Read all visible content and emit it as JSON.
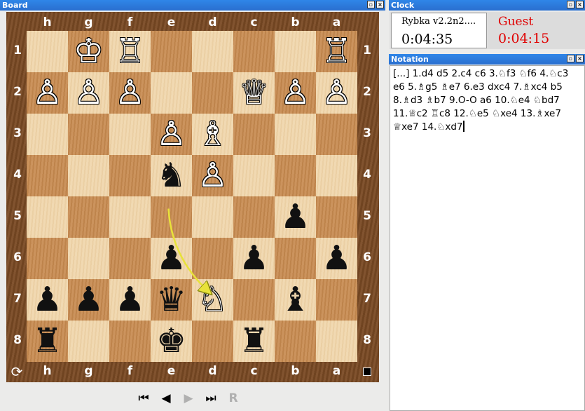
{
  "panels": {
    "board_title": "Board",
    "clock_title": "Clock",
    "notation_title": "Notation"
  },
  "board": {
    "files": [
      "h",
      "g",
      "f",
      "e",
      "d",
      "c",
      "b",
      "a"
    ],
    "ranks": [
      "1",
      "2",
      "3",
      "4",
      "5",
      "6",
      "7",
      "8"
    ],
    "pieces": [
      {
        "sq": "g1",
        "p": "♔",
        "c": "w",
        "name": "white-king"
      },
      {
        "sq": "f1",
        "p": "♖",
        "c": "w",
        "name": "white-rook"
      },
      {
        "sq": "a1",
        "p": "♖",
        "c": "w",
        "name": "white-rook"
      },
      {
        "sq": "h2",
        "p": "♙",
        "c": "w",
        "name": "white-pawn"
      },
      {
        "sq": "g2",
        "p": "♙",
        "c": "w",
        "name": "white-pawn"
      },
      {
        "sq": "f2",
        "p": "♙",
        "c": "w",
        "name": "white-pawn"
      },
      {
        "sq": "c2",
        "p": "♕",
        "c": "w",
        "name": "white-queen"
      },
      {
        "sq": "b2",
        "p": "♙",
        "c": "w",
        "name": "white-pawn"
      },
      {
        "sq": "a2",
        "p": "♙",
        "c": "w",
        "name": "white-pawn"
      },
      {
        "sq": "e3",
        "p": "♙",
        "c": "w",
        "name": "white-pawn"
      },
      {
        "sq": "d3",
        "p": "♗",
        "c": "w",
        "name": "white-bishop"
      },
      {
        "sq": "e4",
        "p": "♞",
        "c": "b",
        "name": "black-knight"
      },
      {
        "sq": "d4",
        "p": "♙",
        "c": "w",
        "name": "white-pawn"
      },
      {
        "sq": "b5",
        "p": "♟",
        "c": "b",
        "name": "black-pawn"
      },
      {
        "sq": "e6",
        "p": "♟",
        "c": "b",
        "name": "black-pawn"
      },
      {
        "sq": "c6",
        "p": "♟",
        "c": "b",
        "name": "black-pawn"
      },
      {
        "sq": "a6",
        "p": "♟",
        "c": "b",
        "name": "black-pawn"
      },
      {
        "sq": "h7",
        "p": "♟",
        "c": "b",
        "name": "black-pawn"
      },
      {
        "sq": "g7",
        "p": "♟",
        "c": "b",
        "name": "black-pawn"
      },
      {
        "sq": "f7",
        "p": "♟",
        "c": "b",
        "name": "black-pawn"
      },
      {
        "sq": "e7",
        "p": "♛",
        "c": "b",
        "name": "black-queen"
      },
      {
        "sq": "d7",
        "p": "♘",
        "c": "w",
        "name": "white-knight"
      },
      {
        "sq": "b7",
        "p": "♝",
        "c": "b",
        "name": "black-bishop"
      },
      {
        "sq": "h8",
        "p": "♜",
        "c": "b",
        "name": "black-rook"
      },
      {
        "sq": "e8",
        "p": "♚",
        "c": "b",
        "name": "black-king"
      },
      {
        "sq": "c8",
        "p": "♜",
        "c": "b",
        "name": "black-rook"
      }
    ],
    "last_move": {
      "from": "e5",
      "to": "d7"
    },
    "arrow_color": "#e8e23a"
  },
  "clock": {
    "left_name": "Rybka v2.2n2....",
    "left_time": "0:04:35",
    "right_name": "Guest",
    "right_time": "0:04:15",
    "right_color": "#e00000"
  },
  "notation": {
    "text": "[...] 1.d4 d5 2.c4 c6 3.♘f3 ♘f6 4.♘c3 e6 5.♗g5 ♗e7 6.e3 dxc4 7.♗xc4 b5 8.♗d3 ♗b7 9.O-O a6 10.♘e4 ♘bd7 11.♕c2 ♖c8 12.♘e5 ♘xe4 13.♗xe7 ♕xe7 14.♘xd7"
  },
  "nav": {
    "first": "⏮",
    "prev": "◀",
    "next": "▶",
    "last": "⏭",
    "resume": "R"
  },
  "icons": {
    "rotate": "rotate-board-icon",
    "side_to_move": "black-to-move-indicator"
  }
}
